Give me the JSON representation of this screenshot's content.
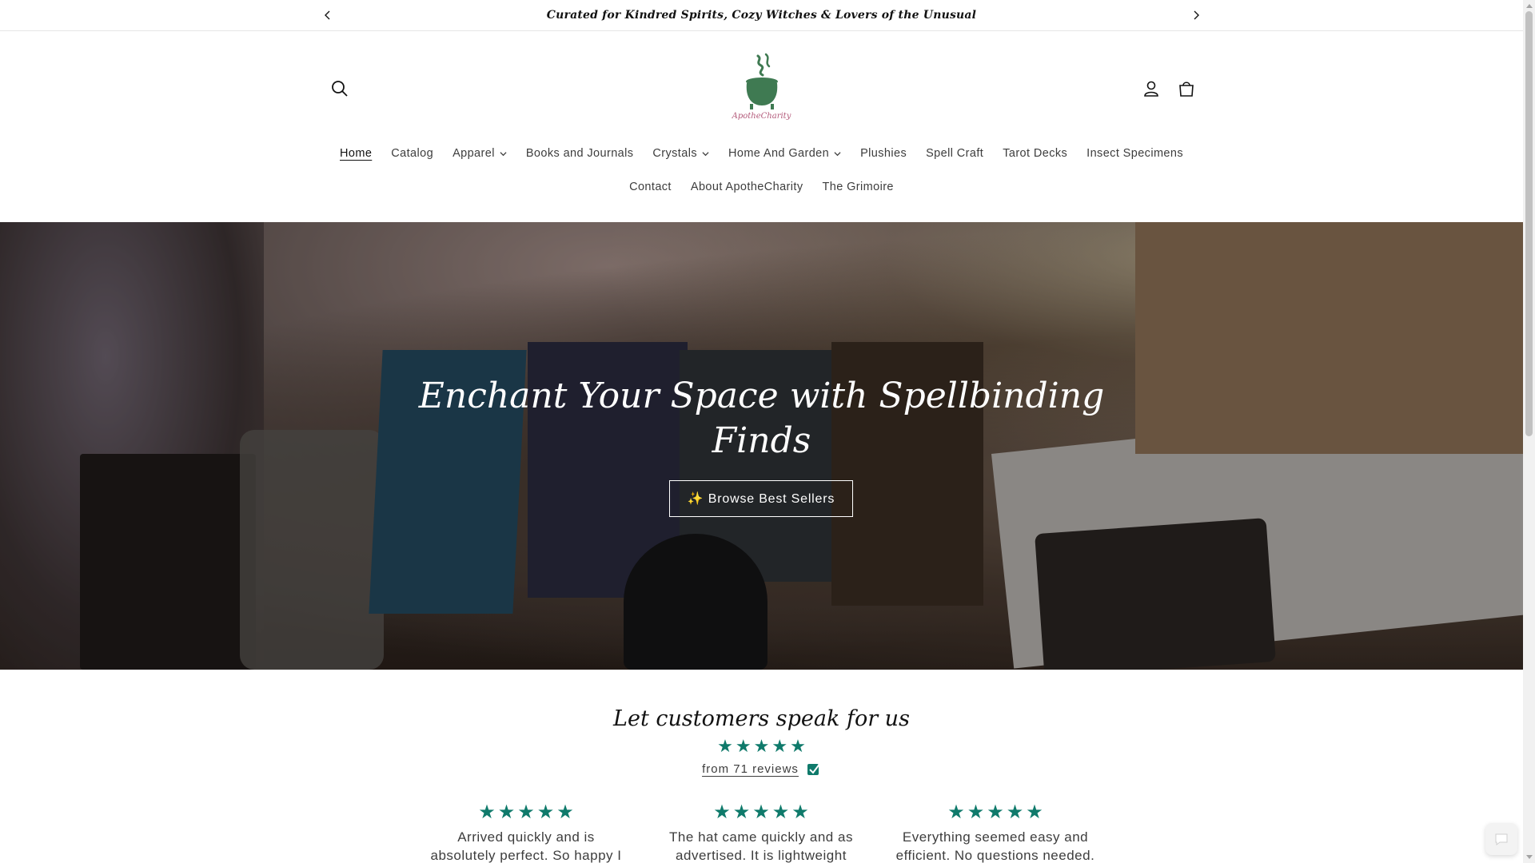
{
  "announcement": {
    "text": "Curated for Kindred Spirits, Cozy Witches & Lovers of the Unusual",
    "prev_icon": "chevron-left-icon",
    "next_icon": "chevron-right-icon"
  },
  "header": {
    "logo_text": "ApotheCharity",
    "icons": {
      "search": "search-icon",
      "account": "account-icon",
      "cart": "cart-icon"
    }
  },
  "nav": {
    "row1": [
      {
        "label": "Home",
        "active": true,
        "dropdown": false
      },
      {
        "label": "Catalog",
        "dropdown": false
      },
      {
        "label": "Apparel",
        "dropdown": true
      },
      {
        "label": "Books and Journals",
        "dropdown": false
      },
      {
        "label": "Crystals",
        "dropdown": true
      },
      {
        "label": "Home And Garden",
        "dropdown": true
      },
      {
        "label": "Plushies",
        "dropdown": false
      },
      {
        "label": "Spell Craft",
        "dropdown": false
      },
      {
        "label": "Tarot Decks",
        "dropdown": false
      },
      {
        "label": "Insect Specimens",
        "dropdown": false
      }
    ],
    "row2": [
      {
        "label": "Contact"
      },
      {
        "label": "About ApotheCharity"
      },
      {
        "label": "The Grimoire"
      }
    ]
  },
  "hero": {
    "title_line1": "Enchant Your Space with Spellbinding",
    "title_line2": "Finds",
    "button_label": "✨ Browse Best Sellers"
  },
  "reviews": {
    "title": "Let customers speak for us",
    "rating_stars": 5,
    "link_text": "from 71 reviews",
    "items": [
      {
        "stars": 5,
        "line1": "Arrived quickly and is",
        "line2": "absolutely perfect. So happy I"
      },
      {
        "stars": 5,
        "line1": "The hat came quickly and as",
        "line2": "advertised. It is lightweight"
      },
      {
        "stars": 5,
        "line1": "Everything seemed easy and",
        "line2": "efficient. No questions needed."
      }
    ]
  },
  "colors": {
    "accent_star": "#0f7a6b",
    "logo_green": "#3f7a52",
    "logo_text": "#b35a7a"
  }
}
